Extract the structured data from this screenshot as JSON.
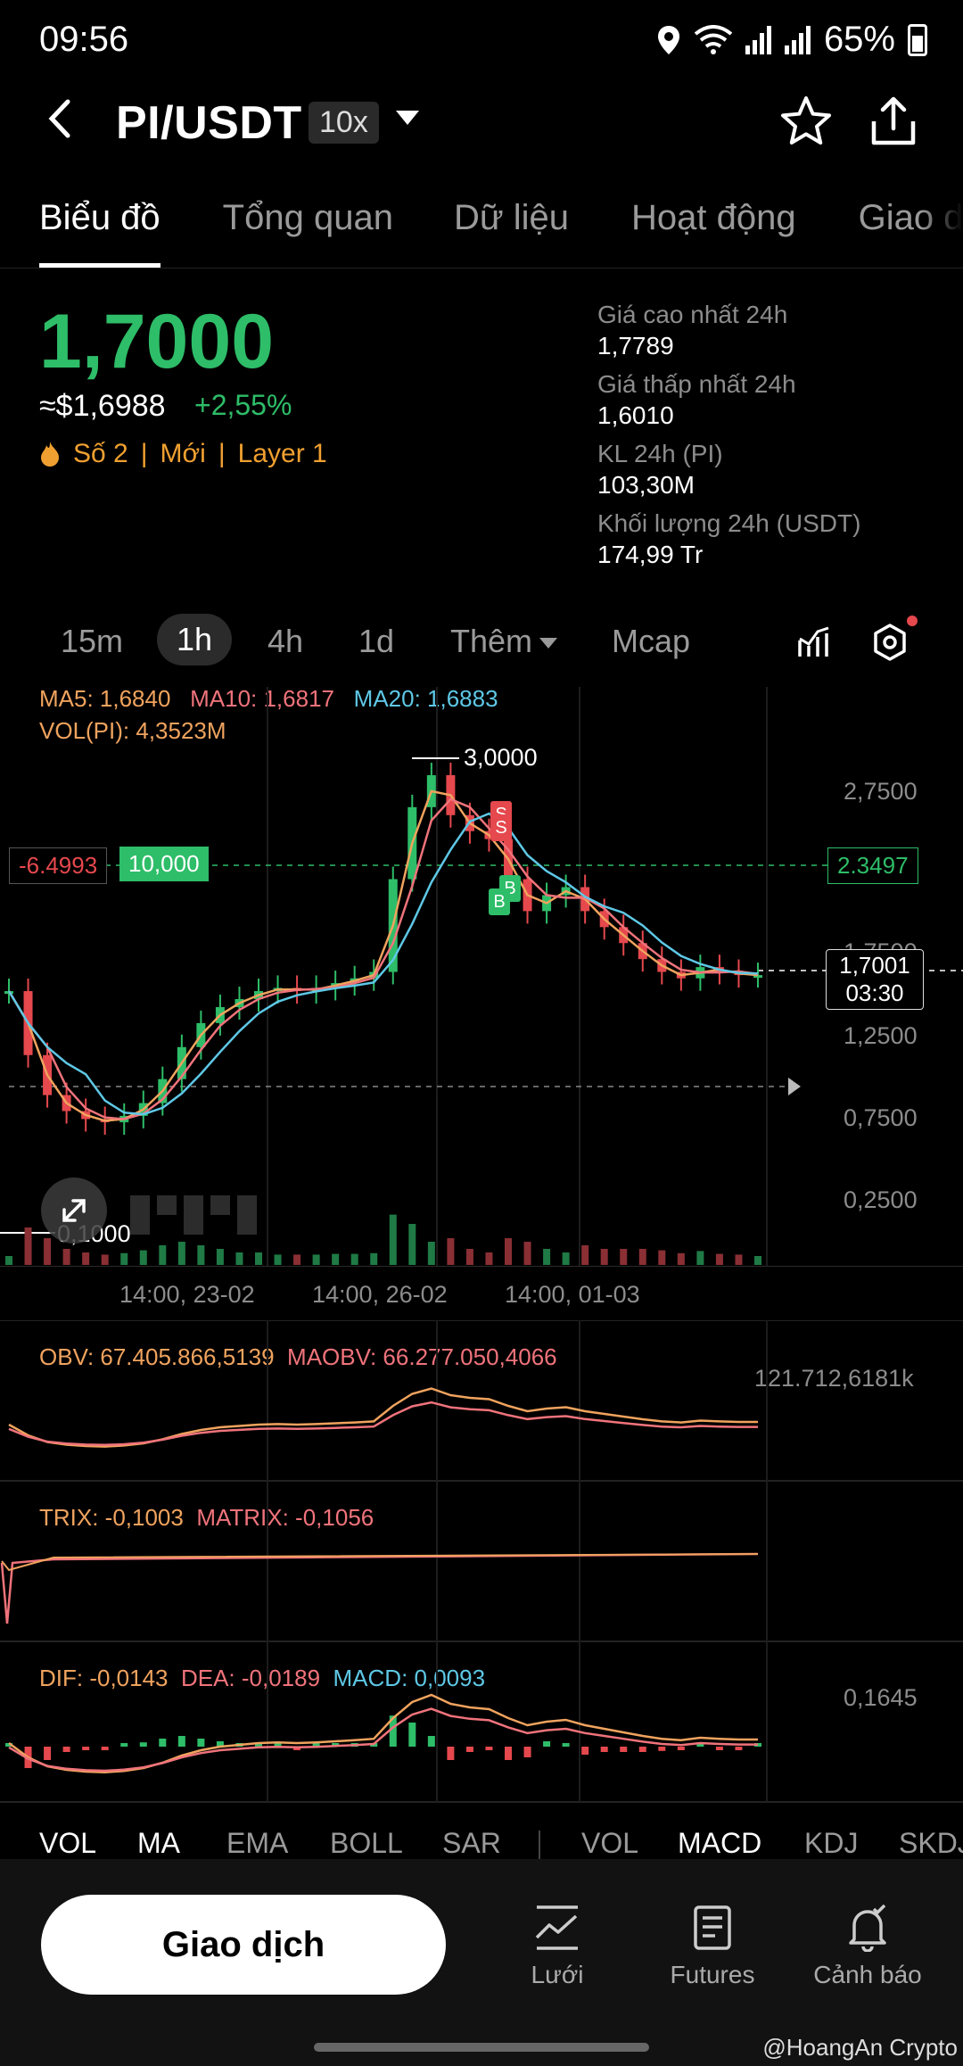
{
  "status": {
    "time": "09:56",
    "battery": "65%"
  },
  "header": {
    "title": "PI/USDT",
    "leverage": "10x"
  },
  "tabs": [
    "Biểu đồ",
    "Tổng quan",
    "Dữ liệu",
    "Hoạt động",
    "Giao d"
  ],
  "price": {
    "last": "1,7000",
    "usd": "≈$1,6988",
    "change": "+2,55%",
    "tags": [
      "Số 2",
      "Mới",
      "Layer 1"
    ],
    "stats": [
      {
        "label": "Giá cao nhất 24h",
        "value": "1,7789"
      },
      {
        "label": "Giá thấp nhất 24h",
        "value": "1,6010"
      },
      {
        "label": "KL 24h (PI)",
        "value": "103,30M"
      },
      {
        "label": "Khối lượng 24h (USDT)",
        "value": "174,99 Tr"
      }
    ]
  },
  "timeframes": {
    "items": [
      "15m",
      "1h",
      "4h",
      "1d",
      "Thêm",
      "Mcap"
    ],
    "active": "1h"
  },
  "indicators": {
    "ma5": "MA5: 1,6840",
    "ma10": "MA10: 1,6817",
    "ma20": "MA20: 1,6883",
    "vol": "VOL(PI): 4,3523M",
    "obv": "OBV: 67.405.866,5139",
    "maobv": "MAOBV: 66.277.050,4066",
    "obv_axis": "121.712,6181k",
    "trix": "TRIX: -0,1003",
    "matrix": "MATRIX: -0,1056",
    "dif": "DIF: -0,0143",
    "dea": "DEA: -0,0189",
    "macd": "MACD: 0,0093",
    "macd_axis": "0,1645"
  },
  "chart": {
    "y_axis": [
      "2,7500",
      "1,7500",
      "1,2500",
      "0,7500",
      "0,2500"
    ],
    "x_axis": [
      "14:00, 23-02",
      "14:00, 26-02",
      "14:00, 01-03"
    ],
    "high_label": "3,0000",
    "low_label": "0,1000",
    "position_pnl": "-6.4993",
    "position_size": "10,000",
    "position_price": "2.3497",
    "current_price": "1,7001",
    "countdown": "03:30",
    "sell_marker": "S",
    "buy_marker": "B"
  },
  "chart_data": {
    "type": "line",
    "title": "",
    "ylim": [
      0.1,
      3.0
    ],
    "x_ticks": [
      "14:00, 23-02",
      "14:00, 26-02",
      "14:00, 01-03"
    ],
    "series": [
      {
        "values": [
          1.6,
          1.2,
          0.95,
          0.85,
          0.8,
          0.78,
          0.82,
          0.9,
          1.05,
          1.25,
          1.4,
          1.5,
          1.55,
          1.6,
          1.62,
          1.6,
          1.62,
          1.65,
          1.68,
          1.72,
          2.3,
          2.75,
          2.95,
          2.7,
          2.6,
          2.55,
          2.3,
          2.1,
          2.2,
          2.25,
          2.1,
          2.0,
          1.9,
          1.8,
          1.72,
          1.68,
          1.75,
          1.72,
          1.7,
          1.7
        ]
      }
    ]
  },
  "indicator_tabs": {
    "main": [
      "VOL",
      "MA",
      "EMA",
      "BOLL",
      "SAR"
    ],
    "sub": [
      "VOL",
      "MACD",
      "KDJ",
      "SKDJ"
    ]
  },
  "bottom_nav": {
    "trade": "Giao dịch",
    "items": [
      "Lưới",
      "Futures",
      "Cảnh báo"
    ]
  },
  "watermark": "@HoangAn Crypto",
  "colors": {
    "up": "#2ebd68",
    "down": "#e5484d",
    "accent": "#f0a030"
  }
}
